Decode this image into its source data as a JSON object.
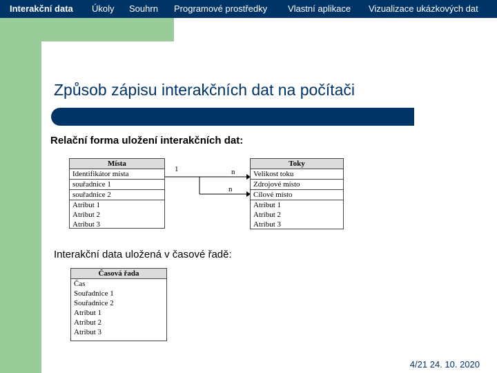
{
  "nav": {
    "items": [
      {
        "label": "Interakční data",
        "active": true
      },
      {
        "label": "Úkoly",
        "active": false
      },
      {
        "label": "Souhrn",
        "active": false
      },
      {
        "label": "Programové prostředky",
        "active": false
      },
      {
        "label": "Vlastní aplikace",
        "active": false
      },
      {
        "label": "Vizualizace ukázkových dat",
        "active": false
      }
    ]
  },
  "slide": {
    "title": "Způsob zápisu interakčních dat na počítači",
    "relational_heading": "Relační forma uložení interakčních dat:",
    "timeseries_heading": "Interakční data uložená v časové řadě:"
  },
  "tables": {
    "mista": {
      "header": "Místa",
      "rows": [
        "Identifikátor místa",
        "souřadnice 1",
        "souřadnice 2",
        "Atribut 1",
        "Atribut 2",
        "Atribut 3"
      ]
    },
    "toky": {
      "header": "Toky",
      "rows": [
        "Velikost toku",
        "Zdrojové místo",
        "Cílové místo",
        "Atribut 1",
        "Atribut 2",
        "Atribut 3"
      ]
    },
    "casova_rada": {
      "header": "Časová řada",
      "rows": [
        "Čas",
        "Souřadnice 1",
        "Souřadnice 2",
        "Atribut 1",
        "Atribut 2",
        "Atribut 3"
      ]
    }
  },
  "relations": {
    "left_cardinality": "1",
    "right_cardinality_1": "n",
    "right_cardinality_2": "n"
  },
  "footer": {
    "page_info": "4/21 24. 10. 2020"
  },
  "colors": {
    "navy": "#003366",
    "green": "#99cc99",
    "white": "#ffffff"
  }
}
